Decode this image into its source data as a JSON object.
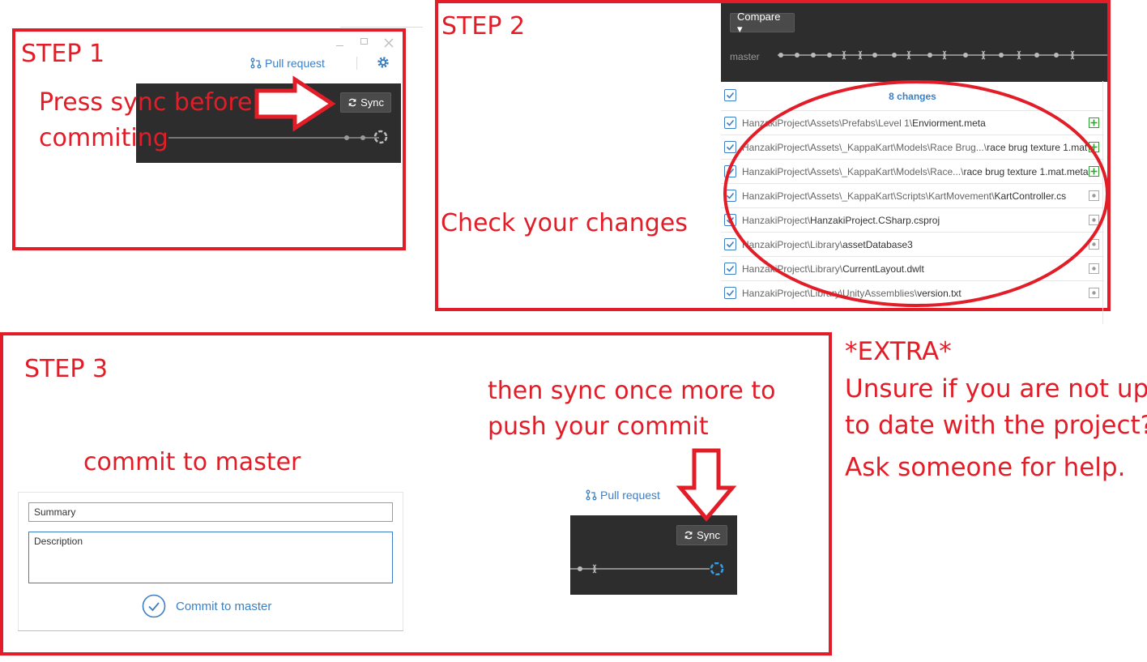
{
  "step1": {
    "title": "STEP 1",
    "pull_request": "Pull request",
    "sync": "Sync",
    "caption_line1": "Press sync before",
    "caption_line2": "commiting",
    "icons": [
      "minimize-icon",
      "maximize-icon",
      "close-icon",
      "pull-request-icon",
      "gear-icon",
      "sync-icon"
    ]
  },
  "step2": {
    "title": "STEP 2",
    "compare": "Compare ▾",
    "branch": "master",
    "changes_count": "8 changes",
    "caption": "Check your changes",
    "files": [
      {
        "dim": "HanzakiProject\\Assets\\Prefabs\\Level 1\\",
        "name": "Enviorment.meta",
        "status": "added"
      },
      {
        "dim": "HanzakiProject\\Assets\\_KappaKart\\Models\\Race Brug...\\",
        "name": "race brug texture 1.mat",
        "status": "added"
      },
      {
        "dim": "HanzakiProject\\Assets\\_KappaKart\\Models\\Race...\\",
        "name": "race brug texture 1.mat.meta",
        "status": "added"
      },
      {
        "dim": "HanzakiProject\\Assets\\_KappaKart\\Scripts\\KartMovement\\",
        "name": "KartController.cs",
        "status": "modified"
      },
      {
        "dim": "HanzakiProject\\",
        "name": "HanzakiProject.CSharp.csproj",
        "status": "modified"
      },
      {
        "dim": "HanzakiProject\\Library\\",
        "name": "assetDatabase3",
        "status": "modified"
      },
      {
        "dim": "HanzakiProject\\Library\\",
        "name": "CurrentLayout.dwlt",
        "status": "modified"
      },
      {
        "dim": "HanzakiProject\\Library\\UnityAssemblies\\",
        "name": "version.txt",
        "status": "modified"
      }
    ]
  },
  "step3": {
    "title": "STEP 3",
    "commit_caption": "commit to master",
    "summary_placeholder": "Summary",
    "description_placeholder": "Description",
    "commit_button": "Commit to master",
    "sync_caption_line1": "then sync once more to",
    "sync_caption_line2": "push your commit",
    "pull_request": "Pull request",
    "sync": "Sync"
  },
  "extra": {
    "title": "*EXTRA*",
    "line1": "Unsure if you are not up",
    "line2": "to date with the project?",
    "line3": "Ask someone for help."
  },
  "colors": {
    "annotation_red": "#e21d28",
    "accent_blue": "#3c7fc4",
    "dark_panel": "#2d2d2d",
    "added_green": "#2ea02e"
  }
}
